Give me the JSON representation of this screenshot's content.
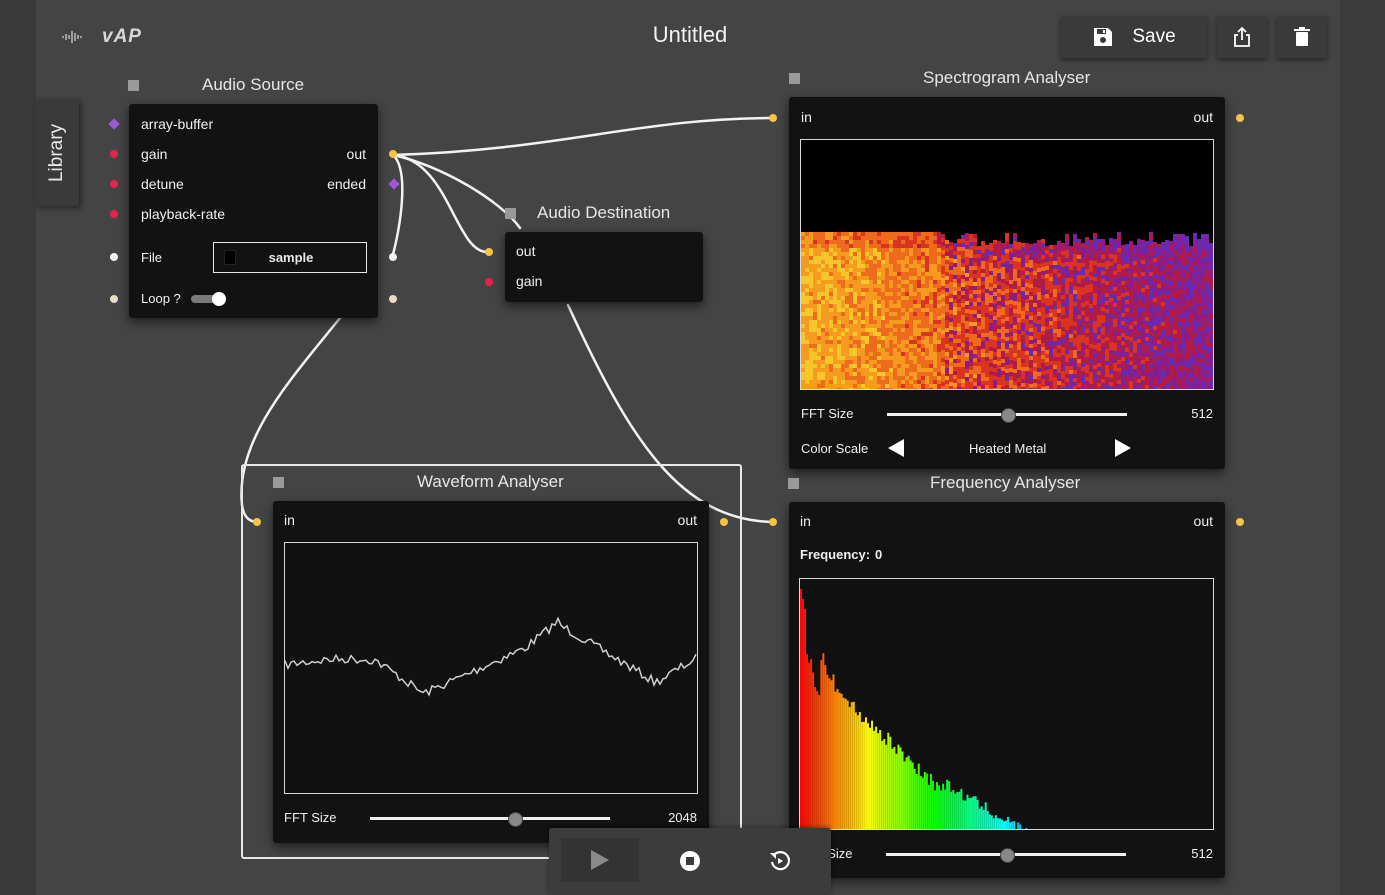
{
  "app": {
    "logo_text": "vAP",
    "title": "Untitled"
  },
  "toolbar": {
    "save_label": "Save",
    "export_icon": "export-icon",
    "delete_icon": "trash-icon"
  },
  "library": {
    "label": "Library"
  },
  "nodes": {
    "audio_source": {
      "title": "Audio Source",
      "inputs": [
        "array-buffer",
        "gain",
        "detune",
        "playback-rate"
      ],
      "outputs": [
        "out",
        "ended"
      ],
      "file_label": "File",
      "file_value": "sample",
      "loop_label": "Loop ?",
      "loop_on": true
    },
    "audio_destination": {
      "title": "Audio Destination",
      "inputs": [
        "out",
        "gain"
      ]
    },
    "spectrogram": {
      "title": "Spectrogram Analyser",
      "in_label": "in",
      "out_label": "out",
      "fft_label": "FFT Size",
      "fft_value": "512",
      "fft_slider": 0.5,
      "color_scale_label": "Color Scale",
      "color_scale_value": "Heated Metal"
    },
    "waveform": {
      "title": "Waveform Analyser",
      "in_label": "in",
      "out_label": "out",
      "fft_label": "FFT Size",
      "fft_value": "2048",
      "fft_slider": 0.6
    },
    "frequency": {
      "title": "Frequency Analyser",
      "in_label": "in",
      "out_label": "out",
      "frequency_label": "Frequency:",
      "frequency_value": "0",
      "fft_label": "FFT Size",
      "fft_value": "512",
      "fft_slider": 0.5
    }
  },
  "colors": {
    "port_signal": "#f5c542",
    "port_param": "#e8214f",
    "port_buffer": "#9b59d6",
    "wire": "#f2f2f2"
  },
  "transport": {
    "play_icon": "play-icon",
    "stop_icon": "stop-icon",
    "replay_icon": "replay-icon"
  }
}
